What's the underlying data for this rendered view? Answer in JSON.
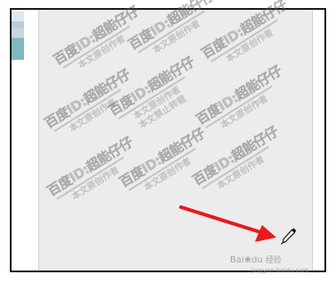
{
  "watermark": {
    "line1": "百度ID:超能仔仔",
    "line2": "本文原创作者",
    "line3": "本文禁止转载"
  },
  "baidu_watermark": {
    "brand_prefix": "Bai",
    "brand_paw": "du",
    "product": "经验",
    "url": "jingyan.baidu.com"
  },
  "icons": {
    "cursor": "eyedropper-icon",
    "annotation": "red-arrow"
  },
  "colors": {
    "canvas": "#ececec",
    "frame_border": "#1a1a1a",
    "arrow": "#e8191b"
  }
}
